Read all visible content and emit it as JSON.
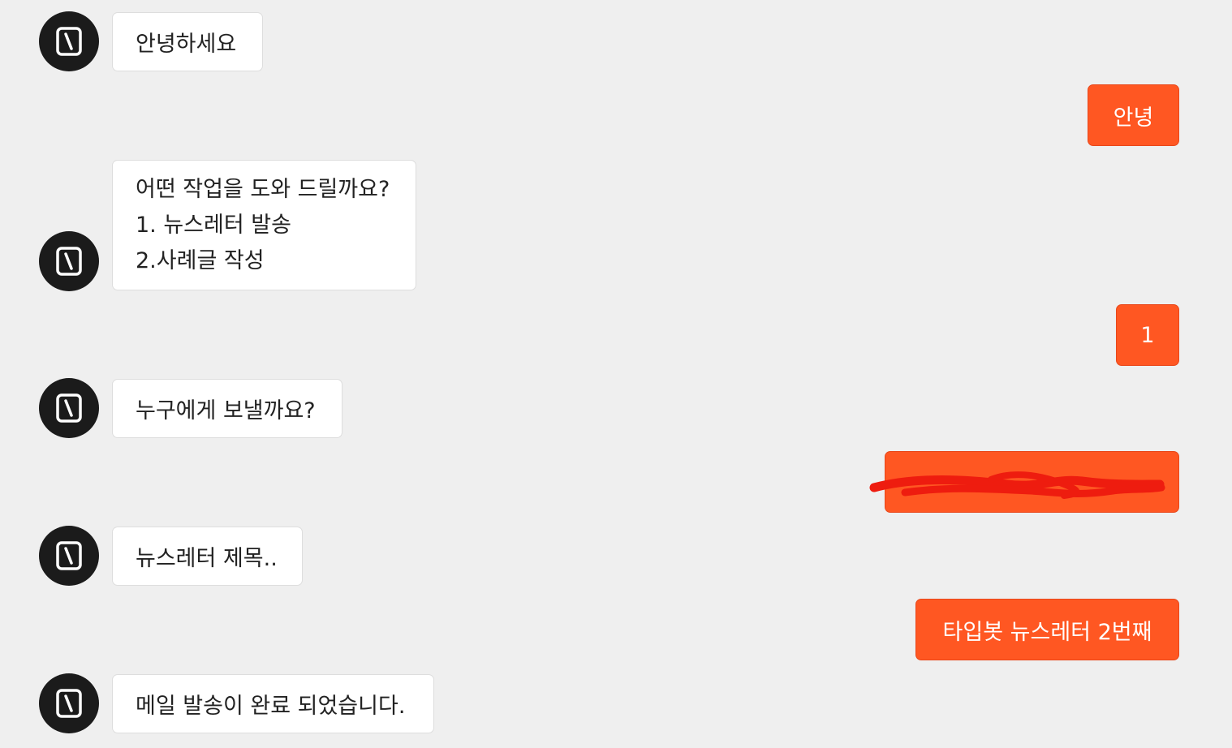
{
  "messages": [
    {
      "role": "bot",
      "lines": [
        "안녕하세요"
      ]
    },
    {
      "role": "user",
      "text": "안녕"
    },
    {
      "role": "bot",
      "lines": [
        "어떤 작업을 도와 드릴까요?",
        "1. 뉴스레터 발송",
        "2.사례글 작성"
      ]
    },
    {
      "role": "user",
      "text": "1"
    },
    {
      "role": "bot",
      "lines": [
        "누구에게 보낼까요?"
      ]
    },
    {
      "role": "user",
      "text": "",
      "redacted": true
    },
    {
      "role": "bot",
      "lines": [
        "뉴스레터 제목.."
      ]
    },
    {
      "role": "user",
      "text": "타입봇 뉴스레터 2번째"
    },
    {
      "role": "bot",
      "lines": [
        "메일 발송이 완료 되었습니다."
      ]
    }
  ],
  "avatar": {
    "icon": "typebot-logo-icon"
  },
  "colors": {
    "background": "#efefef",
    "bot_bubble": "#ffffff",
    "user_bubble": "#ff5722",
    "avatar": "#1b1b1b",
    "redaction": "#ee1c0f"
  }
}
